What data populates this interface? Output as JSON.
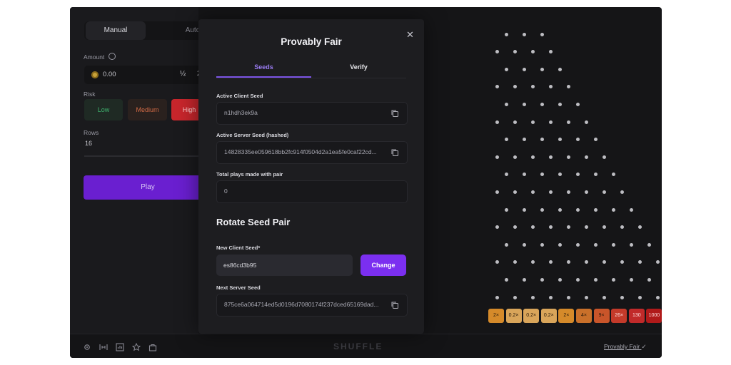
{
  "sidebar": {
    "mode_tabs": [
      "Manual",
      "Auto"
    ],
    "amount_label": "Amount",
    "amount_value": "0.00",
    "half_label": "½",
    "double_label": "2×",
    "risk_label": "Risk",
    "risk_options": [
      "Low",
      "Medium",
      "High"
    ],
    "rows_label": "Rows",
    "rows_value": "16",
    "play_label": "Play"
  },
  "board": {
    "multipliers": [
      "2×",
      "0.2×",
      "0.2×",
      "0.2×",
      "2×",
      "4×",
      "9×",
      "26×",
      "130",
      "1000"
    ],
    "multiplier_colors": [
      "#d58a2a",
      "#d9a55a",
      "#d9a55a",
      "#d9a55a",
      "#d58a2a",
      "#c9702a",
      "#c9552a",
      "#c43a2a",
      "#c12a2a",
      "#b01a1a"
    ]
  },
  "footer": {
    "brand": "SHUFFLE",
    "provably_fair_link": "Provably Fair",
    "icons": [
      "settings-icon",
      "stats-icon",
      "chart-icon",
      "star-icon",
      "bag-icon"
    ]
  },
  "modal": {
    "title": "Provably Fair",
    "tabs": [
      "Seeds",
      "Verify"
    ],
    "active_client_seed_label": "Active Client Seed",
    "active_client_seed": "n1hdh3ek9a",
    "active_server_seed_label": "Active Server Seed (hashed)",
    "active_server_seed": "14828335ee059618bb2fc914f0504d2a1ea5fe0caf22cd...",
    "total_plays_label": "Total plays made with pair",
    "total_plays": "0",
    "rotate_title": "Rotate Seed Pair",
    "new_client_seed_label": "New Client Seed*",
    "new_client_seed": "es86cd3b95",
    "change_label": "Change",
    "next_server_seed_label": "Next Server Seed",
    "next_server_seed": "875ce6a064714ed5d0196d7080174f237dced65169dad..."
  }
}
